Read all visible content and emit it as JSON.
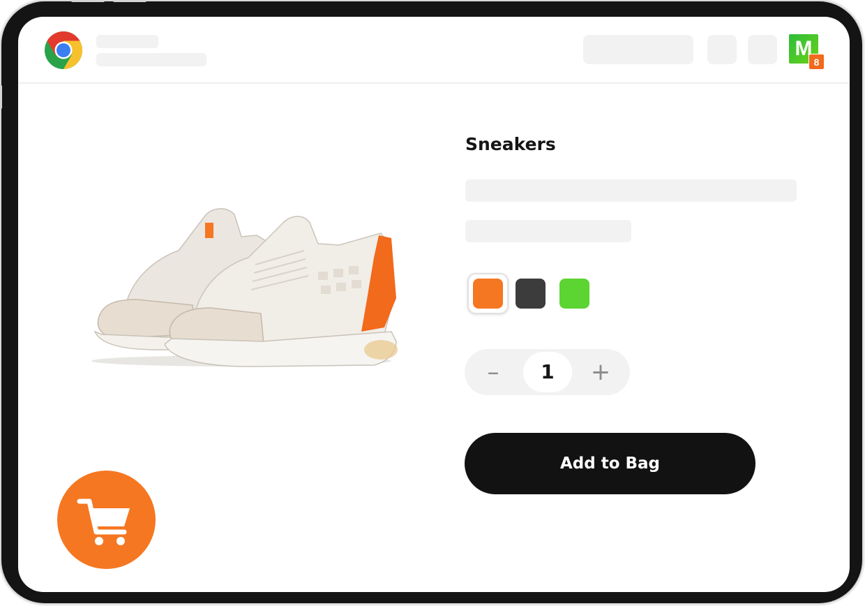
{
  "product": {
    "title": "Sneakers",
    "swatches": [
      {
        "name": "orange",
        "color": "#f57721",
        "selected": true
      },
      {
        "name": "dark-gray",
        "color": "#3c3c3c",
        "selected": false
      },
      {
        "name": "green",
        "color": "#5cd431",
        "selected": false
      }
    ],
    "quantity": {
      "decrement": "–",
      "value": "1",
      "increment": "+"
    },
    "add_to_bag": "Add to Bag"
  },
  "profile": {
    "initial": "M",
    "badge": "8"
  },
  "icons": {
    "browser": "chrome-icon",
    "cart": "shopping-cart-icon"
  },
  "colors": {
    "accent": "#f57721",
    "button": "#121212",
    "skeleton": "#f2f2f3"
  }
}
